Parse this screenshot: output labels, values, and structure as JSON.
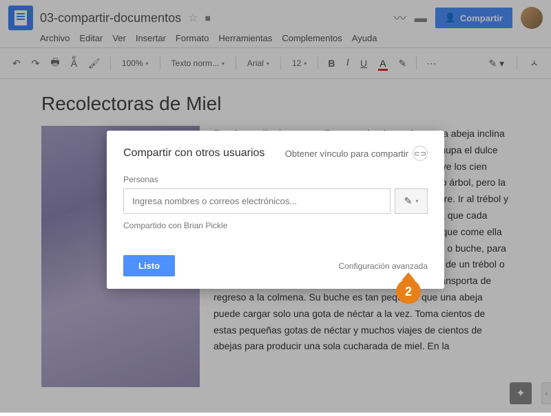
{
  "doc": {
    "title": "03-compartir-documentos",
    "heading": "Recolectoras de Miel",
    "body_text": "Es aún un día de verano. En una soleada pradera, una abeja inclina su cabeza, cuánto sobre un trébol para que llegue. Chupa el dulce néctar escondido en la flor. Está tan ocupada que no ve los cien pétalos y cien pétalos y frutillas deliciosas en el mismo árbol, pero la abeja pasa justo al lado de ella. Ella ya no tiene hambre. Ir al trébol y toma más néctar. Tampoco llega a la colmena y olvida que cada toma el néctar de la colmena."
  },
  "menus": {
    "archivo": "Archivo",
    "editar": "Editar",
    "ver": "Ver",
    "insertar": "Insertar",
    "formato": "Formato",
    "herramientas": "Herramientas",
    "complementos": "Complementos",
    "ayuda": "Ayuda"
  },
  "share_button": "Compartir",
  "toolbar": {
    "zoom": "100%",
    "style": "Texto norm...",
    "font": "Arial",
    "size": "12"
  },
  "modal": {
    "title": "Compartir con otros usuarios",
    "get_link": "Obtener vínculo para compartir",
    "people_label": "Personas",
    "placeholder": "Ingresa nombres o correos electrónicos...",
    "shared_with": "Compartido con Brian Pickle",
    "done": "Listo",
    "advanced": "Configuración avanzada"
  },
  "callout_number": "2",
  "body_continuation": "Uno es para la comida que come ella misma, mientras que el otro es un estómago especial, o buche, para almacenar néctar. Cuando esta ha recolectado néctar de un trébol o una flor de manzana, lo almacena en su buche y lo transporta de regreso a la colmena. Su buche es tan pequeño que una abeja puede cargar solo una gota de néctar a la vez. Toma cientos de estas pequeñas gotas de néctar y muchos viajes de cientos de abejas para producir una sola cucharada de miel. En la"
}
